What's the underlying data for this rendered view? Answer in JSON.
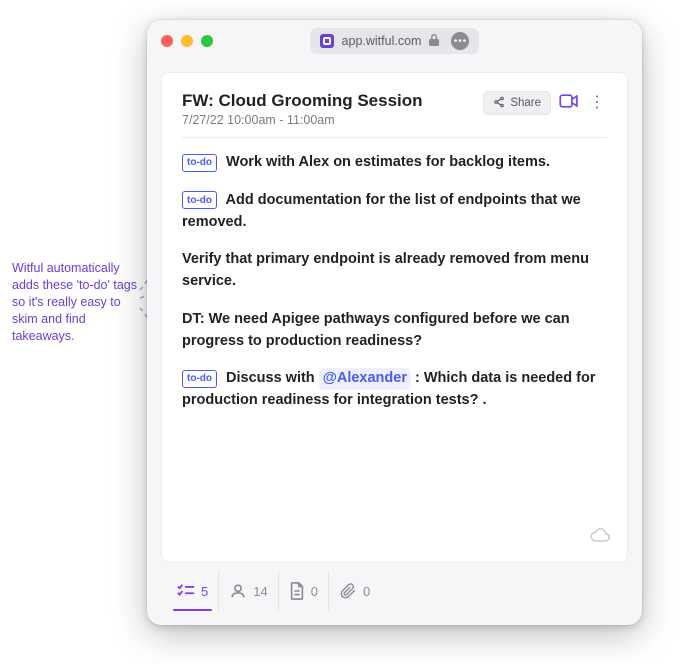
{
  "annotation": {
    "text": "Witful automatically adds these 'to-do' tags so it's really easy to skim and find takeaways."
  },
  "browser": {
    "traffic": {
      "close": "close",
      "minimize": "minimize",
      "zoom": "zoom"
    },
    "address": "app.witful.com"
  },
  "meeting": {
    "title": "FW: Cloud Grooming Session",
    "datetime": "7/27/22 10:00am - 11:00am",
    "share_label": "Share",
    "todo_tag_label": "to-do",
    "mention": "@Alexander",
    "notes": {
      "p1": "Work with Alex on estimates for backlog items.",
      "p2": "Add documentation for the list of endpoints that we removed.",
      "p3": "Verify that primary endpoint is already removed from menu service.",
      "p4": "DT: We need Apigee pathways configured before we can progress to production readiness?",
      "p5a": "Discuss with ",
      "p5b": " : Which data is needed for production readiness for integration tests? ."
    }
  },
  "tabs": {
    "todos_count": "5",
    "people_count": "14",
    "files_count": "0",
    "attachments_count": "0"
  }
}
